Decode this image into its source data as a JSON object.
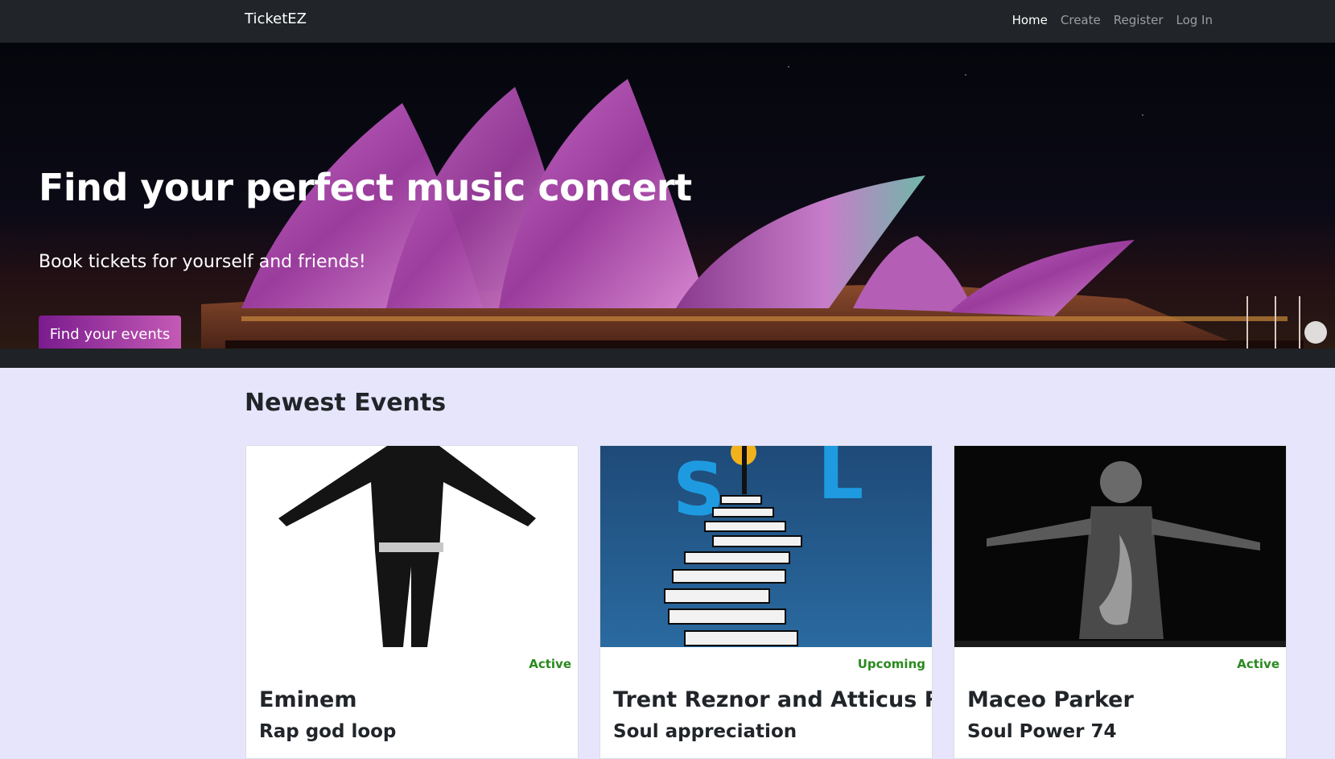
{
  "nav": {
    "brand": "TicketEZ",
    "links": [
      {
        "label": "Home",
        "active": true
      },
      {
        "label": "Create",
        "active": false
      },
      {
        "label": "Register",
        "active": false
      },
      {
        "label": "Log In",
        "active": false
      }
    ]
  },
  "hero": {
    "title": "Find your perfect music concert",
    "subtitle": "Book tickets for yourself and friends!",
    "button_label": "Find your events"
  },
  "section_title": "Newest Events",
  "events": [
    {
      "status": "Active",
      "name": "Eminem",
      "subtitle": "Rap god loop"
    },
    {
      "status": "Upcoming",
      "name": "Trent Reznor and Atticus Ross",
      "subtitle": "Soul appreciation"
    },
    {
      "status": "Active",
      "name": "Maceo Parker",
      "subtitle": "Soul Power 74"
    }
  ],
  "colors": {
    "navbar": "#212529",
    "page_background": "#e6e5fb",
    "button_start": "#7a1b8e",
    "button_end": "#c45ab5",
    "status": "#2a8a1e"
  }
}
